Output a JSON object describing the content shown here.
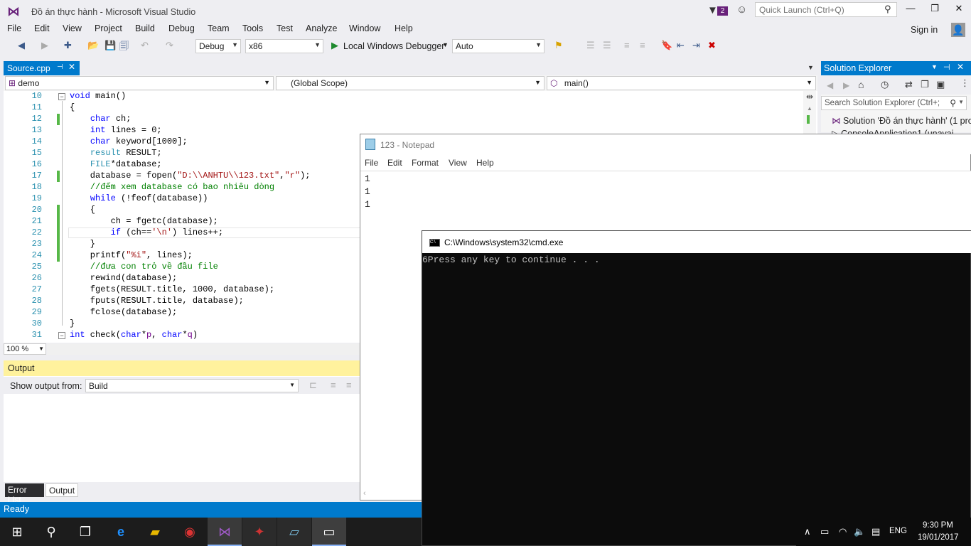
{
  "window": {
    "title": "Đồ án thực hành - Microsoft Visual Studio",
    "notification_count": "2",
    "quick_launch_placeholder": "Quick Launch (Ctrl+Q)",
    "sign_in": "Sign in"
  },
  "menu": [
    "File",
    "Edit",
    "View",
    "Project",
    "Build",
    "Debug",
    "Team",
    "Tools",
    "Test",
    "Analyze",
    "Window",
    "Help"
  ],
  "toolbar": {
    "configuration": "Debug",
    "platform": "x86",
    "run_label": "Local Windows Debugger",
    "run_mode": "Auto"
  },
  "editor": {
    "tab": "Source.cpp",
    "project_combo": "demo",
    "scope_combo": "(Global Scope)",
    "member_combo": "main()",
    "zoom": "100 %",
    "line_numbers": [
      "10",
      "11",
      "12",
      "13",
      "14",
      "15",
      "16",
      "17",
      "18",
      "19",
      "20",
      "21",
      "22",
      "23",
      "24",
      "25",
      "26",
      "27",
      "28",
      "29",
      "30",
      "31"
    ]
  },
  "output": {
    "title": "Output",
    "show_from_label": "Show output from:",
    "show_from_value": "Build",
    "tabs": [
      "Error List",
      "Output"
    ]
  },
  "status": {
    "text": "Ready"
  },
  "solution_explorer": {
    "title": "Solution Explorer",
    "search_placeholder": "Search Solution Explorer (Ctrl+;",
    "items": [
      "Solution 'Đồ án thực hành' (1 pro",
      "ConsoleApplication1 (unavai"
    ]
  },
  "notepad": {
    "title": "123 - Notepad",
    "menu": [
      "File",
      "Edit",
      "Format",
      "View",
      "Help"
    ],
    "lines": [
      "1",
      "1",
      "1"
    ]
  },
  "cmd": {
    "title": "C:\\Windows\\system32\\cmd.exe",
    "output": "6Press any key to continue . . ."
  },
  "taskbar": {
    "language": "ENG",
    "time": "9:30 PM",
    "date": "19/01/2017"
  }
}
